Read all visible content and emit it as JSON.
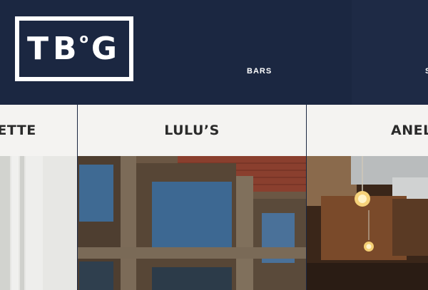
{
  "header": {
    "logo": {
      "text_main": "TB",
      "text_o": "o",
      "text_end": "G"
    },
    "nav": [
      {
        "label": "BARS"
      },
      {
        "label": "S"
      }
    ]
  },
  "cards": [
    {
      "title": "NETTE"
    },
    {
      "title": "LULU’S"
    },
    {
      "title": "ANEL"
    }
  ]
}
